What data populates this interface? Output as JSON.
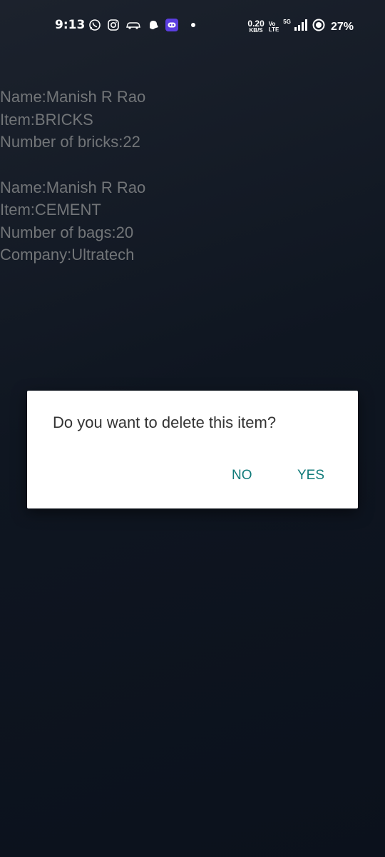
{
  "status_bar": {
    "time": "9:13",
    "net_speed_value": "0.20",
    "net_speed_unit": "KB/S",
    "volte_top": "Vo",
    "volte_bottom": "LTE",
    "network_type": "5G",
    "battery_percent": "27%",
    "left_icons": [
      "whatsapp-icon",
      "instagram-icon",
      "car-icon",
      "ghost-icon",
      "app-badge-icon"
    ],
    "right_icons": [
      "signal-icon",
      "battery-saver-icon"
    ]
  },
  "entries": [
    {
      "lines": [
        "Name:Manish R Rao",
        "Item:BRICKS",
        "Number of bricks:22"
      ]
    },
    {
      "lines": [
        "Name:Manish R Rao",
        "Item:CEMENT",
        "Number of bags:20",
        "Company:Ultratech"
      ]
    }
  ],
  "dialog": {
    "message": "Do you want to delete this item?",
    "negative_label": "NO",
    "positive_label": "YES",
    "accent_color": "#117b7a"
  }
}
